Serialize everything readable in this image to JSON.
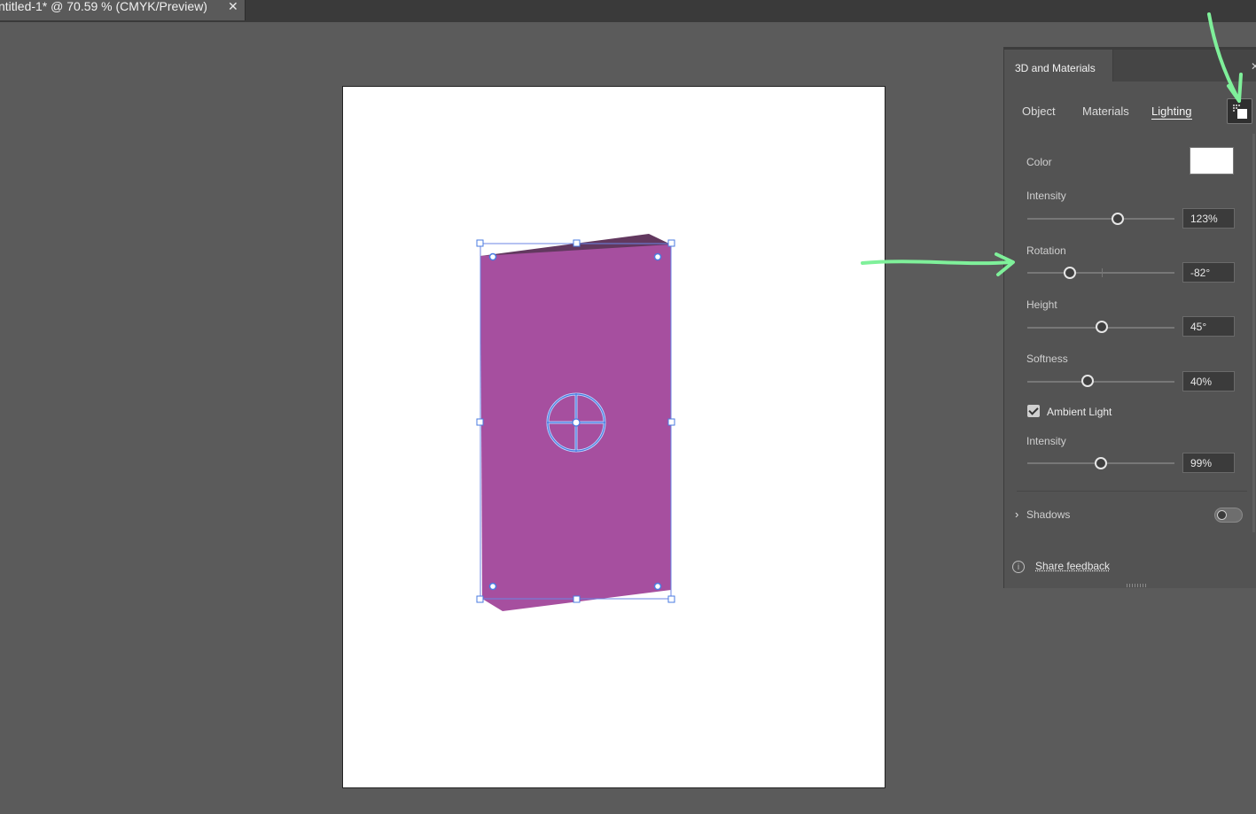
{
  "document": {
    "tab_title": "ntitled-1* @ 70.59 % (CMYK/Preview)",
    "close_glyph": "✕"
  },
  "panel": {
    "title": "3D and Materials",
    "close_glyph": "✕",
    "tabs": [
      "Object",
      "Materials",
      "Lighting"
    ],
    "active_tab": "Lighting",
    "lighting": {
      "color_label": "Color",
      "color_value": "#ffffff",
      "intensity": {
        "label": "Intensity",
        "value": "123%",
        "fraction": 0.61
      },
      "rotation": {
        "label": "Rotation",
        "value": "-82°",
        "fraction": 0.29
      },
      "height": {
        "label": "Height",
        "value": "45°",
        "fraction": 0.5
      },
      "softness": {
        "label": "Softness",
        "value": "40%",
        "fraction": 0.4
      },
      "ambient_light": {
        "label": "Ambient Light",
        "checked": true
      },
      "ambient_intensity": {
        "label": "Intensity",
        "value": "99%",
        "fraction": 0.5
      }
    },
    "shadows": {
      "label": "Shadows",
      "chevron_glyph": "›",
      "enabled": false
    },
    "footer": {
      "info_glyph": "i",
      "feedback_label": "Share feedback"
    }
  },
  "colors": {
    "object_fill": "#a64f9f",
    "object_top": "#62385f",
    "selection": "#4a8ff0",
    "annotation": "#7ff09a"
  }
}
